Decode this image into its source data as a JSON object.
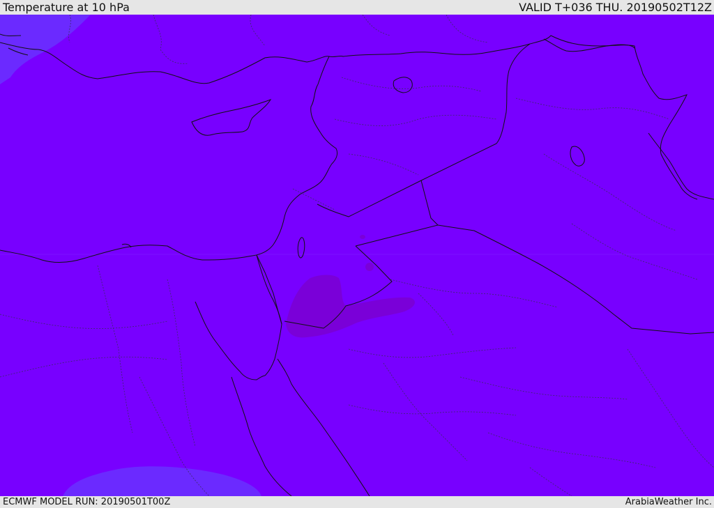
{
  "header": {
    "title": "Temperature at 10 hPa",
    "valid": "VALID T+036 THU. 20190502T12Z"
  },
  "footer": {
    "model_run": "ECMWF MODEL RUN: 20190501T00Z",
    "credit": "ArabiaWeather Inc."
  },
  "colors": {
    "bar_background": "#e6e6e6",
    "field_main": "#7800ff",
    "field_cooler": "#6a2cff",
    "field_warmer": "#7a00d8",
    "coastline": "#111111",
    "border_dotted": "#3b2a66"
  },
  "icons": {
    "map_layer": "temperature-field-map"
  }
}
